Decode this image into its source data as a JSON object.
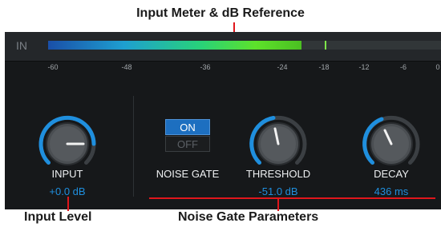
{
  "callouts": {
    "top": "Input Meter & dB Reference",
    "input_level": "Input Level",
    "noise_gate_params": "Noise Gate Parameters"
  },
  "meter": {
    "label": "IN",
    "level_fraction": 0.645,
    "peak_fraction": 0.705,
    "scale": [
      "-60",
      "-48",
      "-36",
      "-24",
      "-18",
      "-12",
      "-6",
      "0"
    ]
  },
  "input": {
    "label": "INPUT",
    "value": "+0.0 dB"
  },
  "noise_gate": {
    "label": "NOISE GATE",
    "on_label": "ON",
    "off_label": "OFF",
    "state": "ON"
  },
  "threshold": {
    "label": "THRESHOLD",
    "value": "-51.0 dB"
  },
  "decay": {
    "label": "DECAY",
    "value": "436 ms"
  },
  "colors": {
    "accent_blue": "#1f8fde",
    "callout_red": "#e0161c",
    "panel_bg": "#16181a"
  },
  "icons": [
    "input-knob-icon",
    "threshold-knob-icon",
    "decay-knob-icon"
  ]
}
